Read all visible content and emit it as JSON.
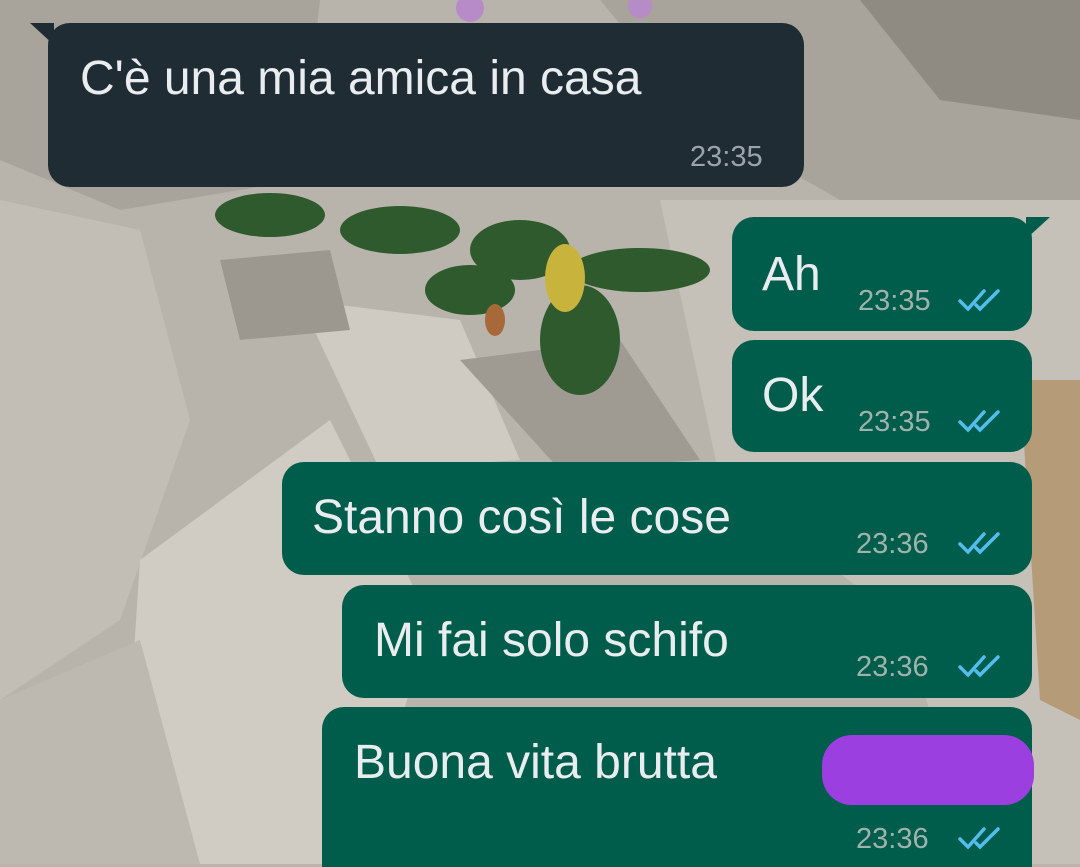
{
  "colors": {
    "incoming_bubble": "#1f2c34",
    "outgoing_bubble": "#005c4b",
    "message_text": "#e9edef",
    "read_ticks": "#53bdeb",
    "redaction": "#9b3fe0"
  },
  "messages": [
    {
      "direction": "incoming",
      "text": "C'è una mia amica in casa",
      "time": "23:35"
    },
    {
      "direction": "outgoing",
      "text": "Ah",
      "time": "23:35",
      "status_icon": "double-check-read-icon"
    },
    {
      "direction": "outgoing",
      "text": "Ok",
      "time": "23:35",
      "status_icon": "double-check-read-icon"
    },
    {
      "direction": "outgoing",
      "text": "Stanno così le cose",
      "time": "23:36",
      "status_icon": "double-check-read-icon"
    },
    {
      "direction": "outgoing",
      "text": "Mi fai solo schifo",
      "time": "23:36",
      "status_icon": "double-check-read-icon"
    },
    {
      "direction": "outgoing",
      "text": "Buona vita brutta",
      "time": "23:36",
      "status_icon": "double-check-read-icon",
      "redacted_word": true
    }
  ]
}
